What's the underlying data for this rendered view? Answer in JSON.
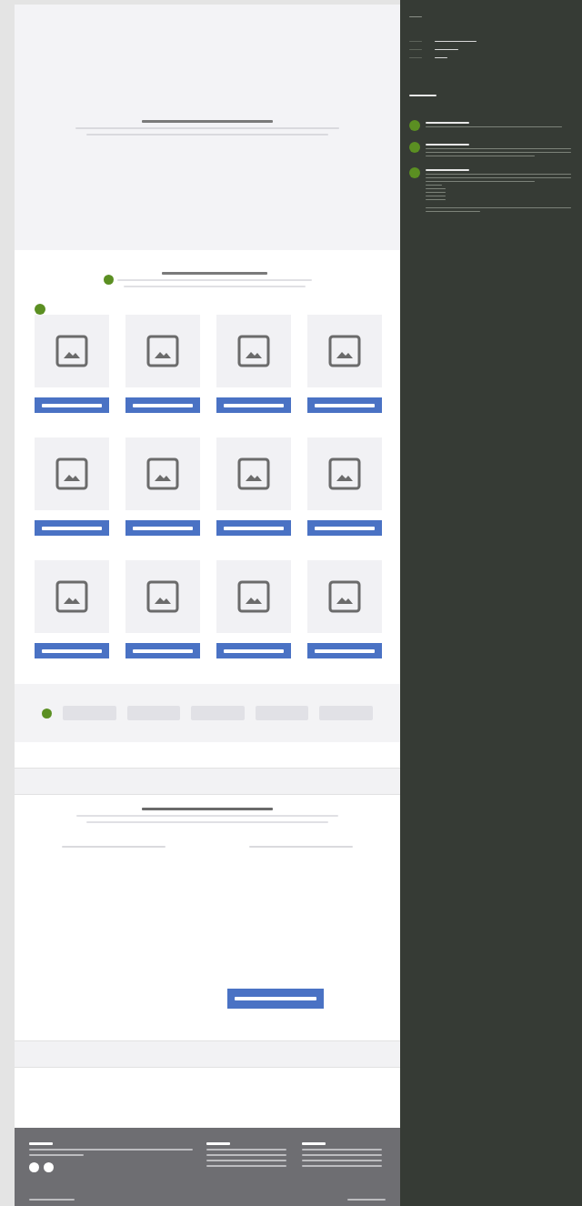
{
  "sections": [
    {
      "kind": "hero"
    },
    {
      "kind": "product-grid",
      "cards": [
        {
          "kind": "image-card"
        },
        {
          "kind": "image-card"
        },
        {
          "kind": "image-card"
        },
        {
          "kind": "image-card"
        },
        {
          "kind": "image-card"
        },
        {
          "kind": "image-card"
        },
        {
          "kind": "image-card"
        },
        {
          "kind": "image-card"
        },
        {
          "kind": "image-card"
        },
        {
          "kind": "image-card"
        },
        {
          "kind": "image-card"
        },
        {
          "kind": "image-card"
        }
      ]
    },
    {
      "kind": "pager",
      "pages": [
        {
          "kind": "page"
        },
        {
          "kind": "page"
        },
        {
          "kind": "page"
        },
        {
          "kind": "page"
        },
        {
          "kind": "page"
        }
      ]
    },
    {
      "kind": "band"
    },
    {
      "kind": "form"
    },
    {
      "kind": "band"
    },
    {
      "kind": "blank"
    },
    {
      "kind": "footer"
    }
  ],
  "side_panel": {
    "meta_rows": [
      {
        "kind": "meta"
      },
      {
        "kind": "meta"
      },
      {
        "kind": "meta"
      }
    ],
    "notes": [
      {
        "kind": "short"
      },
      {
        "kind": "long"
      },
      {
        "kind": "list"
      }
    ]
  }
}
